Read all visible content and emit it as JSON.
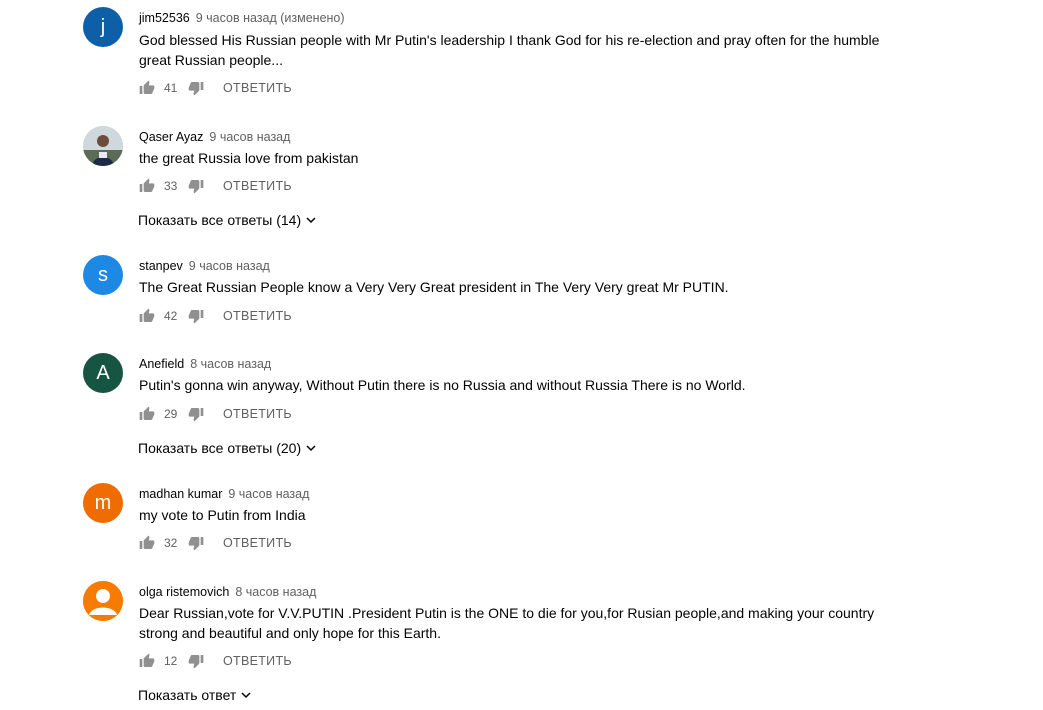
{
  "reply_label": "ОТВЕТИТЬ",
  "comments": [
    {
      "author": "jim52536",
      "time": "9 часов назад (изменено)",
      "text": "God blessed His Russian people with Mr Putin's leadership   I thank God for his re-election and pray often for the humble great Russian people...",
      "likes": "41",
      "avatar": {
        "type": "letter",
        "letter": "j",
        "color": "#0d5fa7"
      }
    },
    {
      "author": "Qaser Ayaz",
      "time": "9 часов назад",
      "text": "the great Russia love from pakistan",
      "likes": "33",
      "avatar": {
        "type": "photo",
        "icon": "user-photo-icon"
      },
      "replies": "Показать все ответы (14)"
    },
    {
      "author": "stanpev",
      "time": "9 часов назад",
      "text": "The Great Russian People know a Very Very Great president in The Very Very great Mr PUTIN.",
      "likes": "42",
      "avatar": {
        "type": "letter",
        "letter": "s",
        "color": "#1e88e5"
      }
    },
    {
      "author": "Anefield",
      "time": "8 часов назад",
      "text": "Putin's gonna win anyway, Without Putin there is no Russia and without Russia There is no World.",
      "likes": "29",
      "avatar": {
        "type": "letter",
        "letter": "A",
        "color": "#175543"
      },
      "replies": "Показать все ответы (20)"
    },
    {
      "author": "madhan kumar",
      "time": "9 часов назад",
      "text": "my vote to Putin from India",
      "likes": "32",
      "avatar": {
        "type": "letter",
        "letter": "m",
        "color": "#ef6c00"
      }
    },
    {
      "author": "olga ristemovich",
      "time": "8 часов назад",
      "text": "Dear Russian,vote for V.V.PUTIN .President Putin is the ONE to die for you,for Rusian people,and making your country strong and beautiful and only hope for this Earth.",
      "likes": "12",
      "avatar": {
        "type": "default",
        "color": "#f57c00",
        "icon": "default-user-icon"
      },
      "replies": "Показать ответ"
    }
  ]
}
